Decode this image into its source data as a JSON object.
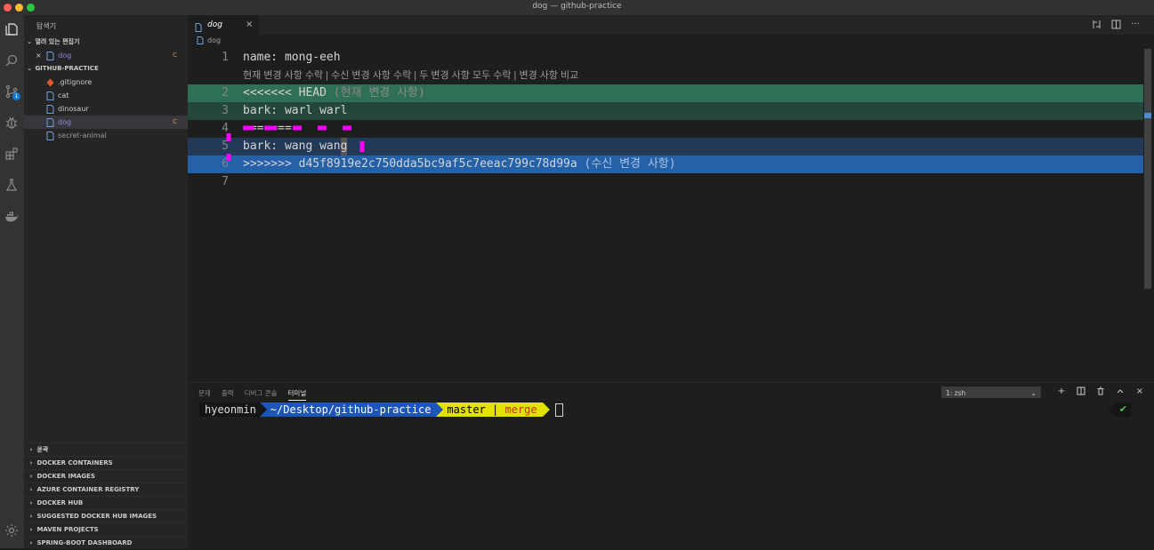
{
  "window": {
    "title": "dog — github-practice"
  },
  "activity": {
    "items": [
      {
        "icon": "files-icon"
      },
      {
        "icon": "search-icon"
      },
      {
        "icon": "source-control-icon",
        "badge": "1"
      },
      {
        "icon": "debug-icon"
      },
      {
        "icon": "extensions-icon"
      },
      {
        "icon": "test-icon"
      },
      {
        "icon": "docker-icon"
      }
    ],
    "bottom_icon": "gear-icon"
  },
  "sidebar": {
    "title": "탐색기",
    "open_editors_label": "열려 있는 편집기",
    "open_editor": {
      "name": "dog",
      "status": "C"
    },
    "project_label": "GITHUB-PRACTICE",
    "files": [
      {
        "name": ".gitignore",
        "status": ""
      },
      {
        "name": "cat",
        "status": ""
      },
      {
        "name": "dinosaur",
        "status": ""
      },
      {
        "name": "dog",
        "status": "C"
      },
      {
        "name": "secret-animal",
        "status": ""
      }
    ],
    "bottom_sections": [
      "윤곽",
      "DOCKER CONTAINERS",
      "DOCKER IMAGES",
      "AZURE CONTAINER REGISTRY",
      "DOCKER HUB",
      "SUGGESTED DOCKER HUB IMAGES",
      "MAVEN PROJECTS",
      "SPRING-BOOT DASHBOARD"
    ]
  },
  "editor": {
    "tab": {
      "label": "dog",
      "close": "×"
    },
    "breadcrumb": "dog",
    "codelens": "현재 변경 사항 수락 | 수신 변경 사항 수락 | 두 변경 사항 모두 수락 | 변경 사항 비교",
    "lines": [
      {
        "num": "1",
        "text": "name: mong-eeh"
      },
      {
        "num": "2",
        "text": "<<<<<<< HEAD",
        "note": " (현재 변경 사항)"
      },
      {
        "num": "3",
        "text": "bark: warl warl"
      },
      {
        "num": "4",
        "text": "======="
      },
      {
        "num": "5",
        "text": "bark: wang wan",
        "cursor_char": "g"
      },
      {
        "num": "6",
        "text": ">>>>>>> d45f8919e2c750dda5bc9af5c7eeac799c78d99a",
        "note": " (수신 변경 사항)"
      },
      {
        "num": "7",
        "text": ""
      }
    ]
  },
  "panel": {
    "tabs": [
      "문제",
      "출력",
      "디버그 콘솔",
      "터미널"
    ],
    "active_tab": "터미널",
    "terminal_select": "1: zsh",
    "prompt": {
      "user": "hyeonmin",
      "path": "~/Desktop/github-practice",
      "branch_icon": "",
      "branch": "master",
      "separator": "|",
      "state": "merge",
      "status": "✔"
    }
  },
  "colors": {
    "accent": "#0e7ad3",
    "current_change": "#2f6f56",
    "incoming_change": "#2461a6",
    "annotation": "#ff00ff"
  }
}
